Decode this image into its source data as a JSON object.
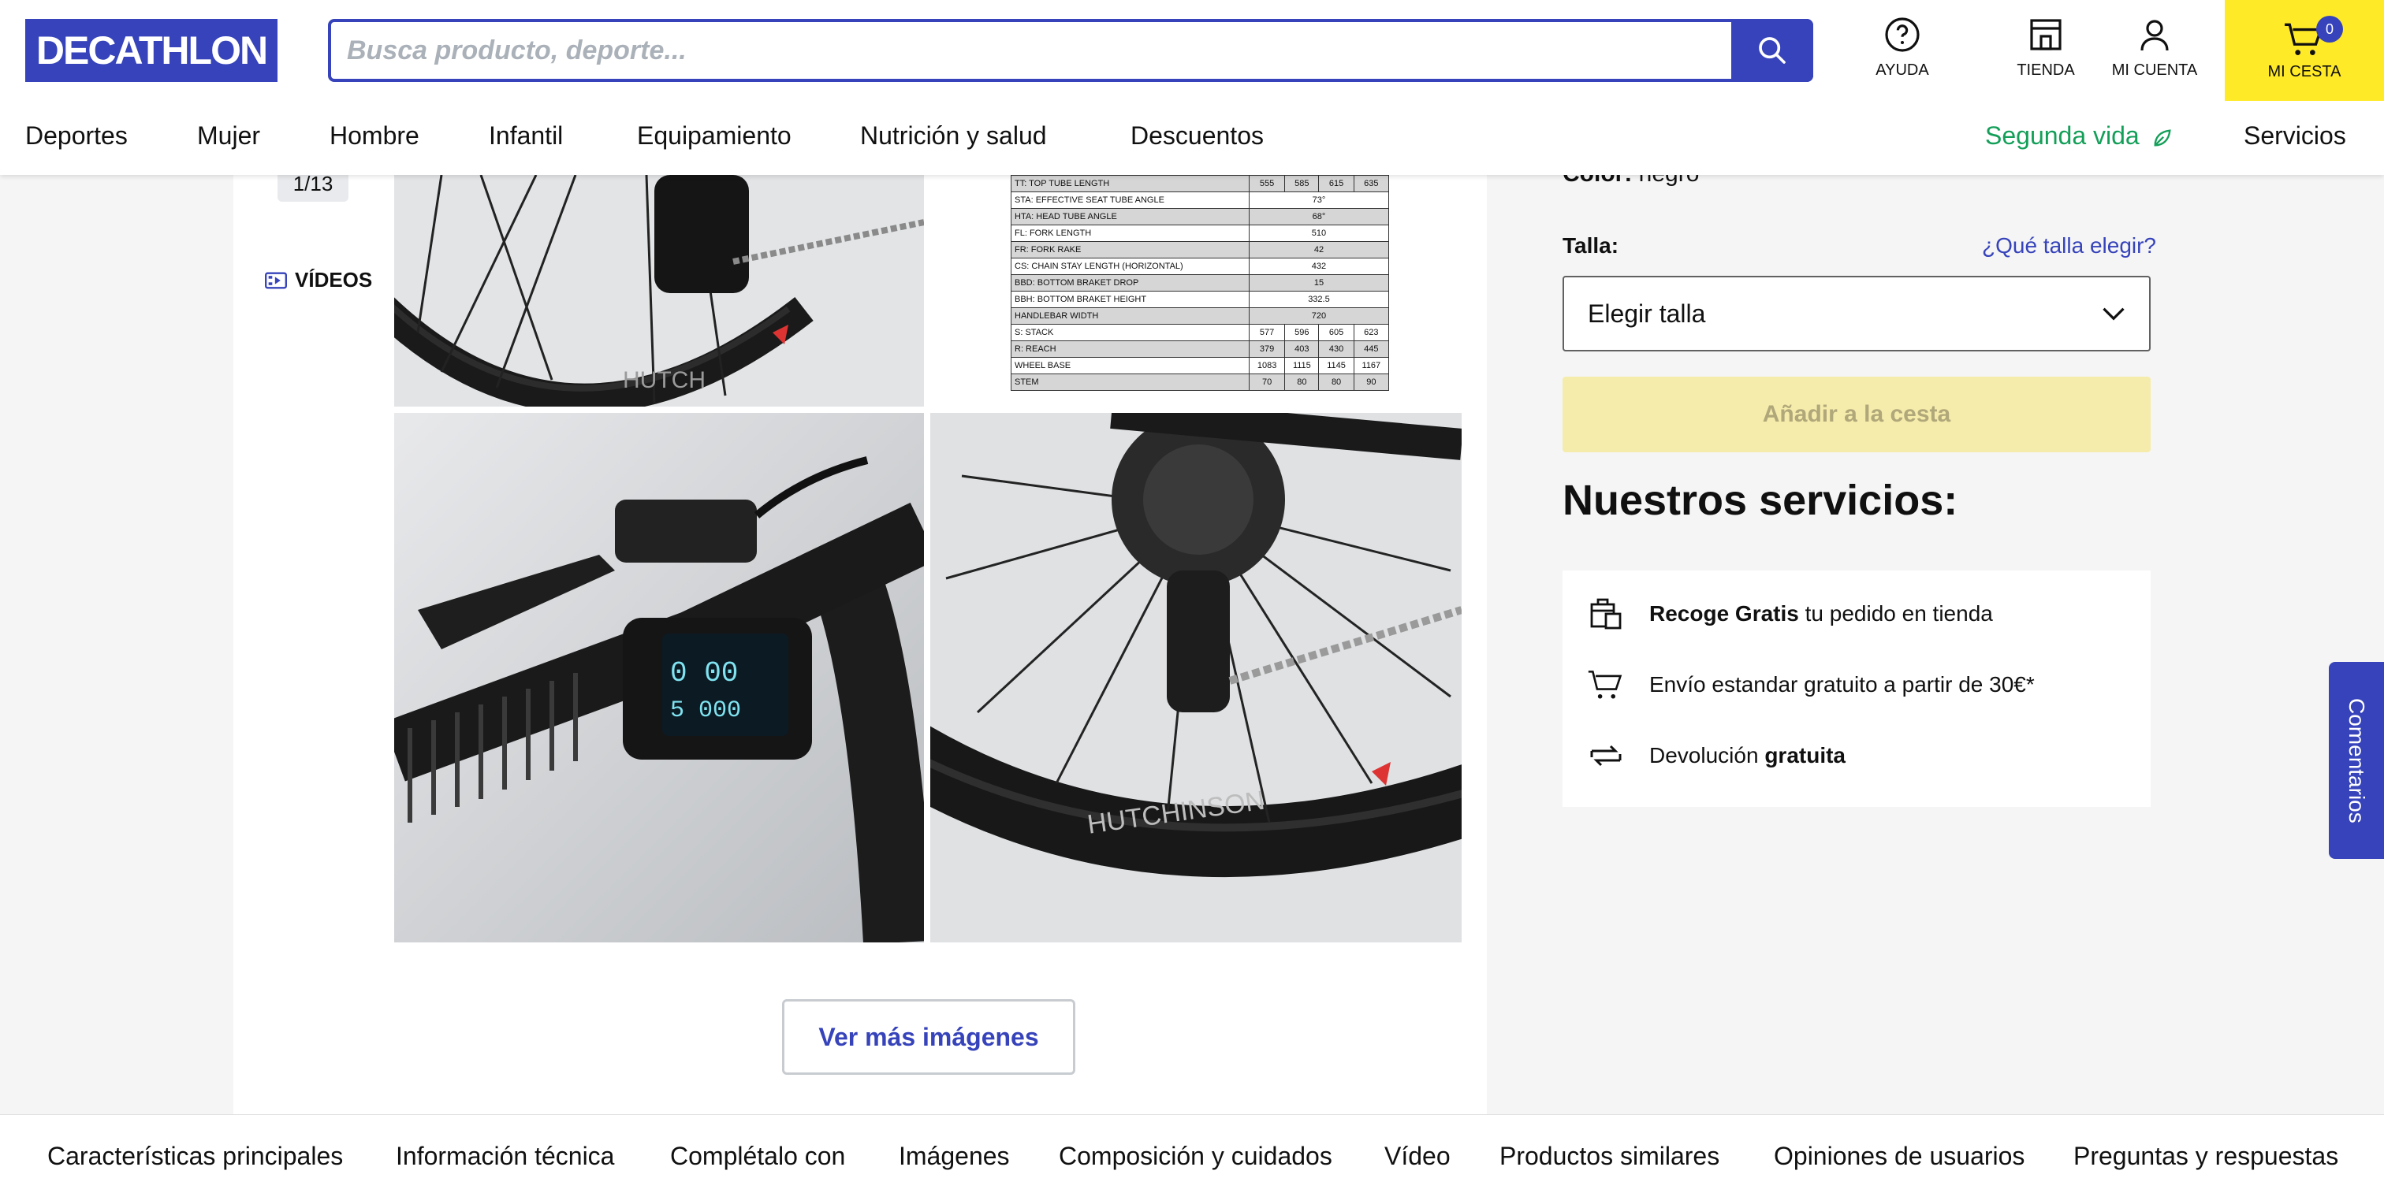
{
  "brand": "DECATHLON",
  "search": {
    "placeholder": "Busca producto, deporte..."
  },
  "header_actions": {
    "help": "AYUDA",
    "store": "TIENDA",
    "account": "MI CUENTA",
    "cart": "MI CESTA",
    "cart_count": "0"
  },
  "nav": {
    "items": [
      "Deportes",
      "Mujer",
      "Hombre",
      "Infantil",
      "Equipamiento",
      "Nutrición y salud",
      "Descuentos"
    ],
    "segunda_vida": "Segunda vida",
    "servicios": "Servicios"
  },
  "gallery": {
    "counter": "1/13",
    "videos": "VÍDEOS",
    "more_button": "Ver más imágenes",
    "geometry_table": [
      [
        "TT: TOP TUBE LENGTH",
        "555",
        "585",
        "615",
        "635"
      ],
      [
        "STA: EFFECTIVE SEAT TUBE ANGLE",
        "73°"
      ],
      [
        "HTA: HEAD TUBE ANGLE",
        "68°"
      ],
      [
        "FL: FORK LENGTH",
        "510"
      ],
      [
        "FR: FORK RAKE",
        "42"
      ],
      [
        "CS: CHAIN STAY LENGTH (HORIZONTAL)",
        "432"
      ],
      [
        "BBD: BOTTOM BRAKET DROP",
        "15"
      ],
      [
        "BBH: BOTTOM BRAKET HEIGHT",
        "332.5"
      ],
      [
        "HANDLEBAR WIDTH",
        "720"
      ],
      [
        "S: STACK",
        "577",
        "596",
        "605",
        "623"
      ],
      [
        "R: REACH",
        "379",
        "403",
        "430",
        "445"
      ],
      [
        "WHEEL BASE",
        "1083",
        "1115",
        "1145",
        "1167"
      ],
      [
        "STEM",
        "70",
        "80",
        "80",
        "90"
      ]
    ]
  },
  "product": {
    "color_label": "Color:",
    "color_value": "negro",
    "size_label": "Talla:",
    "size_help": "¿Qué talla elegir?",
    "size_select": "Elegir talla",
    "add_to_cart": "Añadir a la cesta"
  },
  "services": {
    "title": "Nuestros servicios:",
    "items": [
      {
        "bold": "Recoge Gratis",
        "text": " tu pedido en tienda",
        "icon": "store-pickup-icon"
      },
      {
        "bold": "",
        "text": "Envío estandar gratuito a partir de 30€*",
        "icon": "cart-icon"
      },
      {
        "bold": "gratuita",
        "text": "Devolución ",
        "icon": "return-icon"
      }
    ]
  },
  "comments_tab": "Comentarios",
  "bottom_tabs": [
    "Características principales",
    "Información técnica",
    "Complétalo con",
    "Imágenes",
    "Composición y cuidados",
    "Vídeo",
    "Productos similares",
    "Opiniones de usuarios",
    "Preguntas y respuestas"
  ],
  "colors": {
    "brand_blue": "#3643ba",
    "cart_yellow": "#ffea28",
    "green": "#149f59"
  }
}
